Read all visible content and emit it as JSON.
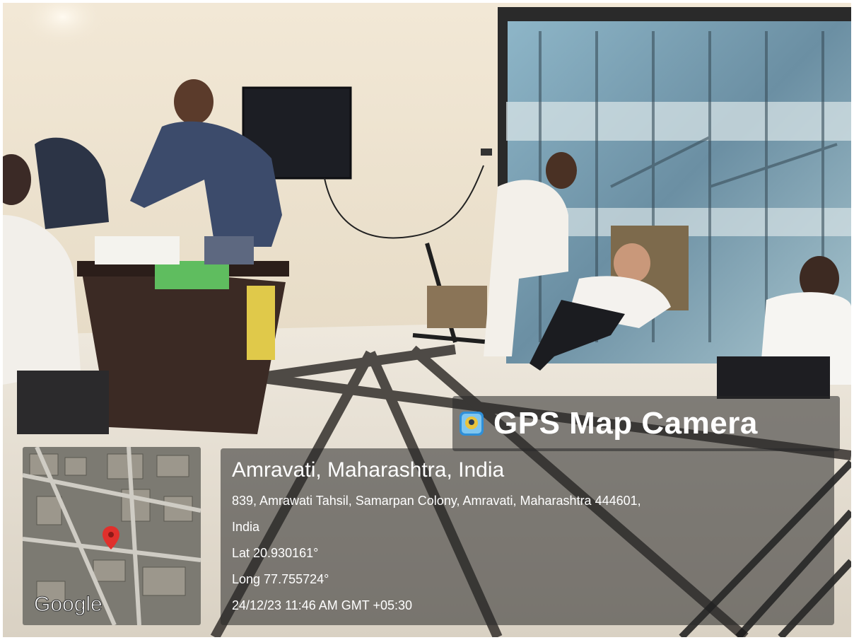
{
  "overlay": {
    "brand_name": "GPS Map Camera",
    "brand_icon": "gps-camera-app-icon",
    "location_title": "Amravati, Maharashtra, India",
    "address_line1": "839, Amrawati Tahsil, Samarpan Colony, Amravati, Maharashtra 444601,",
    "address_line2": "India",
    "latitude": "Lat 20.930161°",
    "longitude": "Long 77.755724°",
    "datetime": "24/12/23 11:46 AM GMT +05:30",
    "map_label": "Google"
  },
  "colors": {
    "overlay_bg": "#282828",
    "map_pin": "#e0302c",
    "brand_icon_bg": "#2f8fd8"
  }
}
